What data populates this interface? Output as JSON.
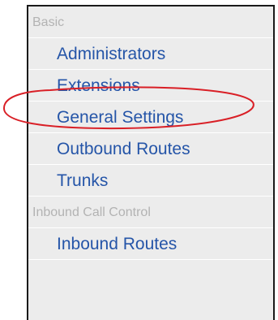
{
  "sections": [
    {
      "header": "Basic",
      "items": [
        {
          "label": "Administrators"
        },
        {
          "label": "Extensions"
        },
        {
          "label": "General Settings"
        },
        {
          "label": "Outbound Routes"
        },
        {
          "label": "Trunks"
        }
      ]
    },
    {
      "header": "Inbound Call Control",
      "items": [
        {
          "label": "Inbound Routes"
        }
      ]
    }
  ],
  "annotation": {
    "highlighted_item": "Extensions",
    "color": "#d91f26"
  },
  "colors": {
    "panel_background": "#ececec",
    "link_text": "#2555a8",
    "section_header_text": "#b3b3b3",
    "panel_border": "#1a1a1a"
  }
}
